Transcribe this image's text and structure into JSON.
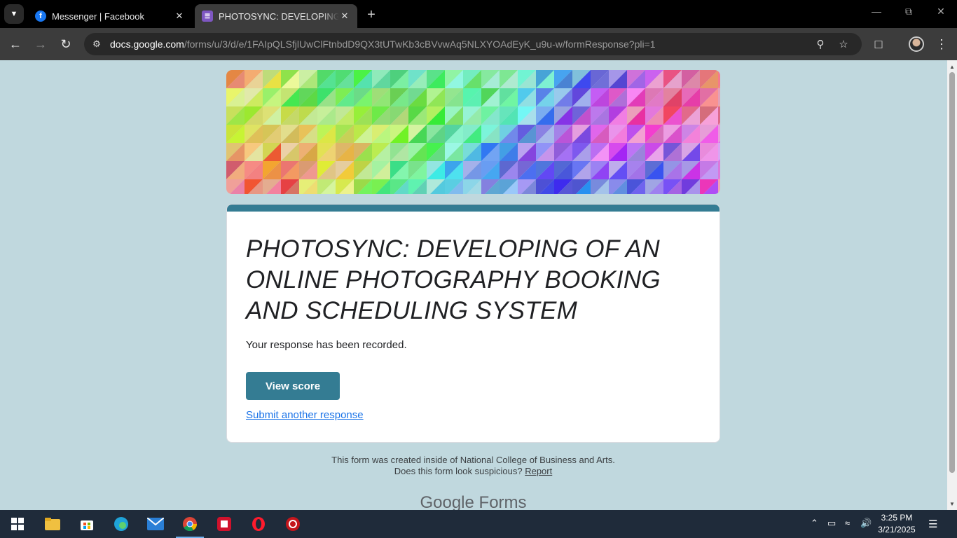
{
  "browser": {
    "tabs": [
      {
        "title": "Messenger | Facebook",
        "icon": "facebook-icon"
      },
      {
        "title": "PHOTOSYNC: DEVELOPING OF AN ONLINE PHOTOGRAPHY BOOKING AND SCHEDULING SYSTEM",
        "icon": "google-forms-icon"
      }
    ],
    "url_host": "docs.google.com",
    "url_path": "/forms/u/3/d/e/1FAIpQLSfjlUwClFtnbdD9QX3tUTwKb3cBVvwAq5NLXYOAdEyK_u9u-w/formResponse?pli=1"
  },
  "form": {
    "title": "PHOTOSYNC: DEVELOPING OF AN ONLINE PHOTOGRAPHY BOOKING AND SCHEDULING SYSTEM",
    "confirmation": "Your response has been recorded.",
    "view_score_label": "View score",
    "submit_another_label": "Submit another response",
    "accent_color": "#347c93"
  },
  "footer": {
    "created_inside": "This form was created inside of National College of Business and Arts.",
    "suspicious": "Does this form look suspicious?",
    "report": "Report",
    "brand": "Google Forms"
  },
  "taskbar": {
    "time": "3:25 PM",
    "date": "3/21/2025"
  }
}
